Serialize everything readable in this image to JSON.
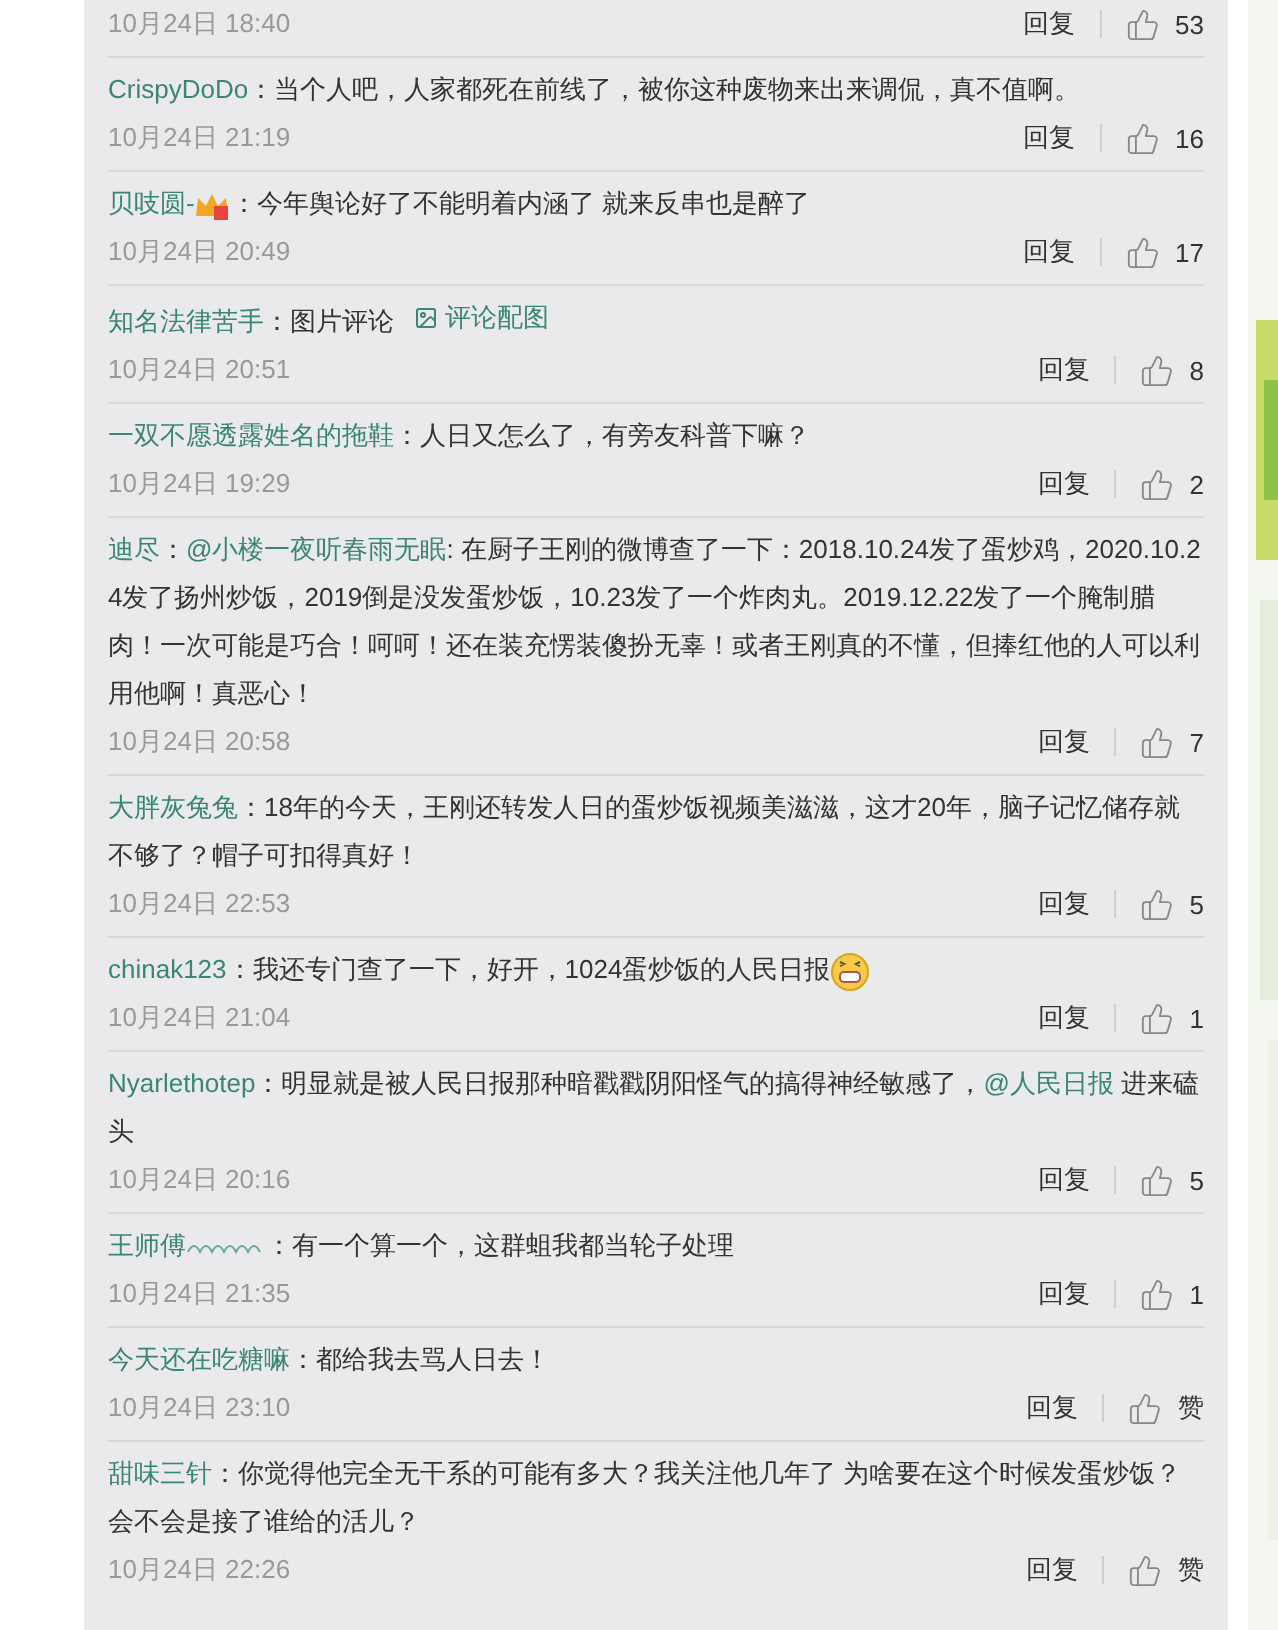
{
  "comments": [
    {
      "time": "10月24日 18:40",
      "reply": "回复",
      "likes": "53"
    },
    {
      "name": "CrispyDoDo",
      "parts": [
        {
          "kind": "text",
          "text": "：当个人吧，人家都死在前线了，被你这种废物来出来调侃，真不值啊。"
        }
      ],
      "time": "10月24日 21:19",
      "reply": "回复",
      "likes": "16"
    },
    {
      "name": "贝吱圆-",
      "parts": [
        {
          "kind": "badge"
        },
        {
          "kind": "text",
          "text": "：今年舆论好了不能明着内涵了 就来反串也是醉了"
        }
      ],
      "time": "10月24日 20:49",
      "reply": "回复",
      "likes": "17"
    },
    {
      "name": "知名法律苦手",
      "parts": [
        {
          "kind": "text",
          "text": "：图片评论 "
        },
        {
          "kind": "image_link",
          "text": "评论配图"
        }
      ],
      "time": "10月24日 20:51",
      "reply": "回复",
      "likes": "8"
    },
    {
      "name": "一双不愿透露姓名的拖鞋",
      "parts": [
        {
          "kind": "text",
          "text": "：人日又怎么了，有旁友科普下嘛？"
        }
      ],
      "time": "10月24日 19:29",
      "reply": "回复",
      "likes": "2"
    },
    {
      "name": "迪尽",
      "parts": [
        {
          "kind": "text",
          "text": "："
        },
        {
          "kind": "link",
          "text": "@小楼一夜听春雨无眠"
        },
        {
          "kind": "text",
          "text": ": 在厨子王刚的微博查了一下：2018.10.24发了蛋炒鸡，2020.10.24发了扬州炒饭，2019倒是没发蛋炒饭，10.23发了一个炸肉丸。2019.12.22发了一个腌制腊肉！一次可能是巧合！呵呵！还在装充愣装傻扮无辜！或者王刚真的不懂，但捧红他的人可以利用他啊！真恶心！"
        }
      ],
      "time": "10月24日 20:58",
      "reply": "回复",
      "likes": "7"
    },
    {
      "name": "大胖灰兔兔",
      "parts": [
        {
          "kind": "text",
          "text": "：18年的今天，王刚还转发人日的蛋炒饭视频美滋滋，这才20年，脑子记忆储存就不够了？帽子可扣得真好！"
        }
      ],
      "time": "10月24日 22:53",
      "reply": "回复",
      "likes": "5"
    },
    {
      "name": "chinak123",
      "parts": [
        {
          "kind": "text",
          "text": "：我还专门查了一下，好开，1024蛋炒饭的人民日报"
        },
        {
          "kind": "emoji"
        }
      ],
      "time": "10月24日 21:04",
      "reply": "回复",
      "likes": "1"
    },
    {
      "name": "Nyarlethotep",
      "parts": [
        {
          "kind": "text",
          "text": "：明显就是被人民日报那种暗戳戳阴阳怪气的搞得神经敏感了，"
        },
        {
          "kind": "link",
          "text": "@人民日报"
        },
        {
          "kind": "text",
          "text": " 进来磕头"
        }
      ],
      "time": "10月24日 20:16",
      "reply": "回复",
      "likes": "5"
    },
    {
      "name": "王师傅",
      "parts": [
        {
          "kind": "squiggle"
        },
        {
          "kind": "text",
          "text": "：有一个算一个，这群蛆我都当轮子处理"
        }
      ],
      "time": "10月24日 21:35",
      "reply": "回复",
      "likes": "1"
    },
    {
      "name": "今天还在吃糖嘛",
      "parts": [
        {
          "kind": "text",
          "text": "：都给我去骂人日去！"
        }
      ],
      "time": "10月24日 23:10",
      "reply": "回复",
      "likes": "赞"
    },
    {
      "name": "甜味三针",
      "parts": [
        {
          "kind": "text",
          "text": "：你觉得他完全无干系的可能有多大？我关注他几年了 为啥要在这个时候发蛋炒饭？会不会是接了谁给的活儿？"
        }
      ],
      "time": "10月24日 22:26",
      "reply": "回复",
      "likes": "赞"
    }
  ]
}
